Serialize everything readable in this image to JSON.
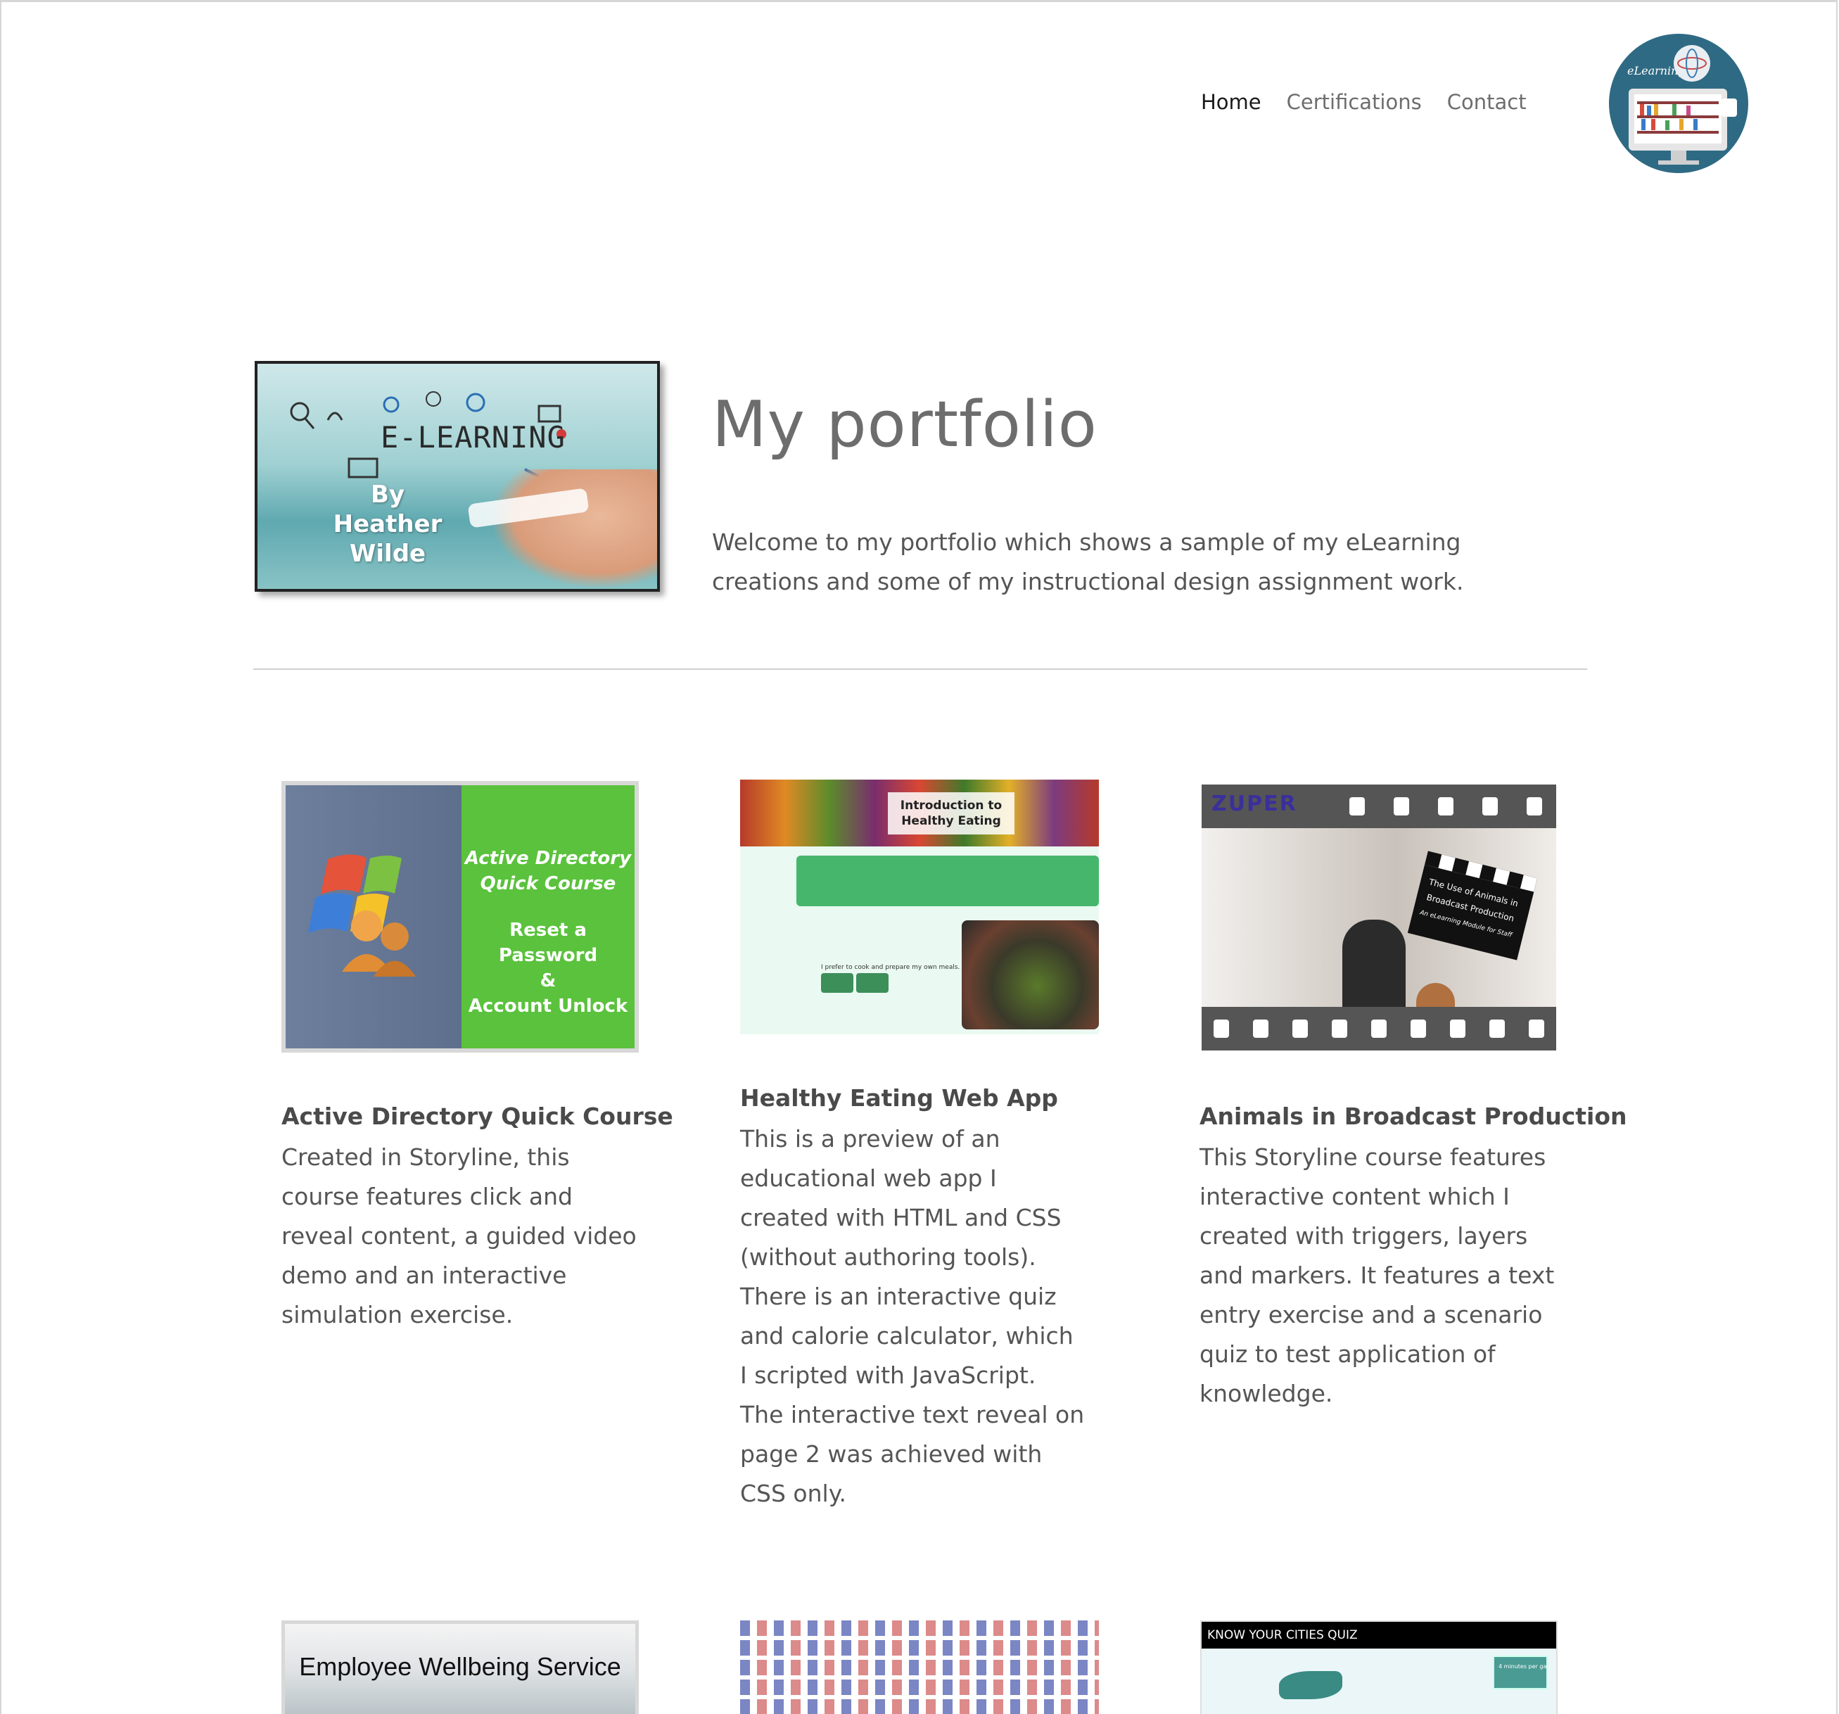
{
  "nav": {
    "items": [
      "Home",
      "Certifications",
      "Contact"
    ],
    "active": "Home"
  },
  "logo": {
    "icon": "elearning-logo",
    "caption": "eLearning"
  },
  "hero": {
    "image_title": "E-LEARNING",
    "image_byline_1": "By",
    "image_byline_2": "Heather Wilde",
    "title": "My portfolio",
    "text": "Welcome to my portfolio which shows a sample of my eLearning creations and some of my instructional design assignment work."
  },
  "cards": [
    {
      "image_line_1": "Active Directory",
      "image_line_2": "Quick Course",
      "image_line_3": "Reset a Password",
      "image_line_4": "&",
      "image_line_5": "Account Unlock",
      "title": "Active Directory Quick Course",
      "text": "Created in Storyline, this course features click and reveal content, a guided video demo and an interactive simulation exercise."
    },
    {
      "image_heading_1": "Introduction to",
      "image_heading_2": "Healthy Eating",
      "image_question": "I prefer to cook and prepare my own meals.",
      "image_btn_true": "True",
      "image_btn_false": "False",
      "title": "Healthy Eating Web App",
      "text": "This is a preview of an educational web app I created with HTML and CSS (without authoring tools).  There is an interactive quiz and calorie calculator, which I scripted with JavaScript.  The interactive text reveal on page 2 was achieved with CSS only."
    },
    {
      "image_brand": "ZUPER",
      "image_clapper_1": "The Use of Animals in",
      "image_clapper_2": "Broadcast Production",
      "image_clapper_3": "An eLearning Module for Staff",
      "title": "Animals in Broadcast Production",
      "text": "This Storyline course features interactive content which I created with triggers, layers and markers. It features a text entry exercise and a scenario quiz to test application of knowledge."
    }
  ],
  "row2": {
    "card4_image_title": "Employee Wellbeing Service",
    "card6_image_header": "KNOW YOUR CITIES QUIZ",
    "card6_badge": "4 minutes per game starting from now!"
  }
}
